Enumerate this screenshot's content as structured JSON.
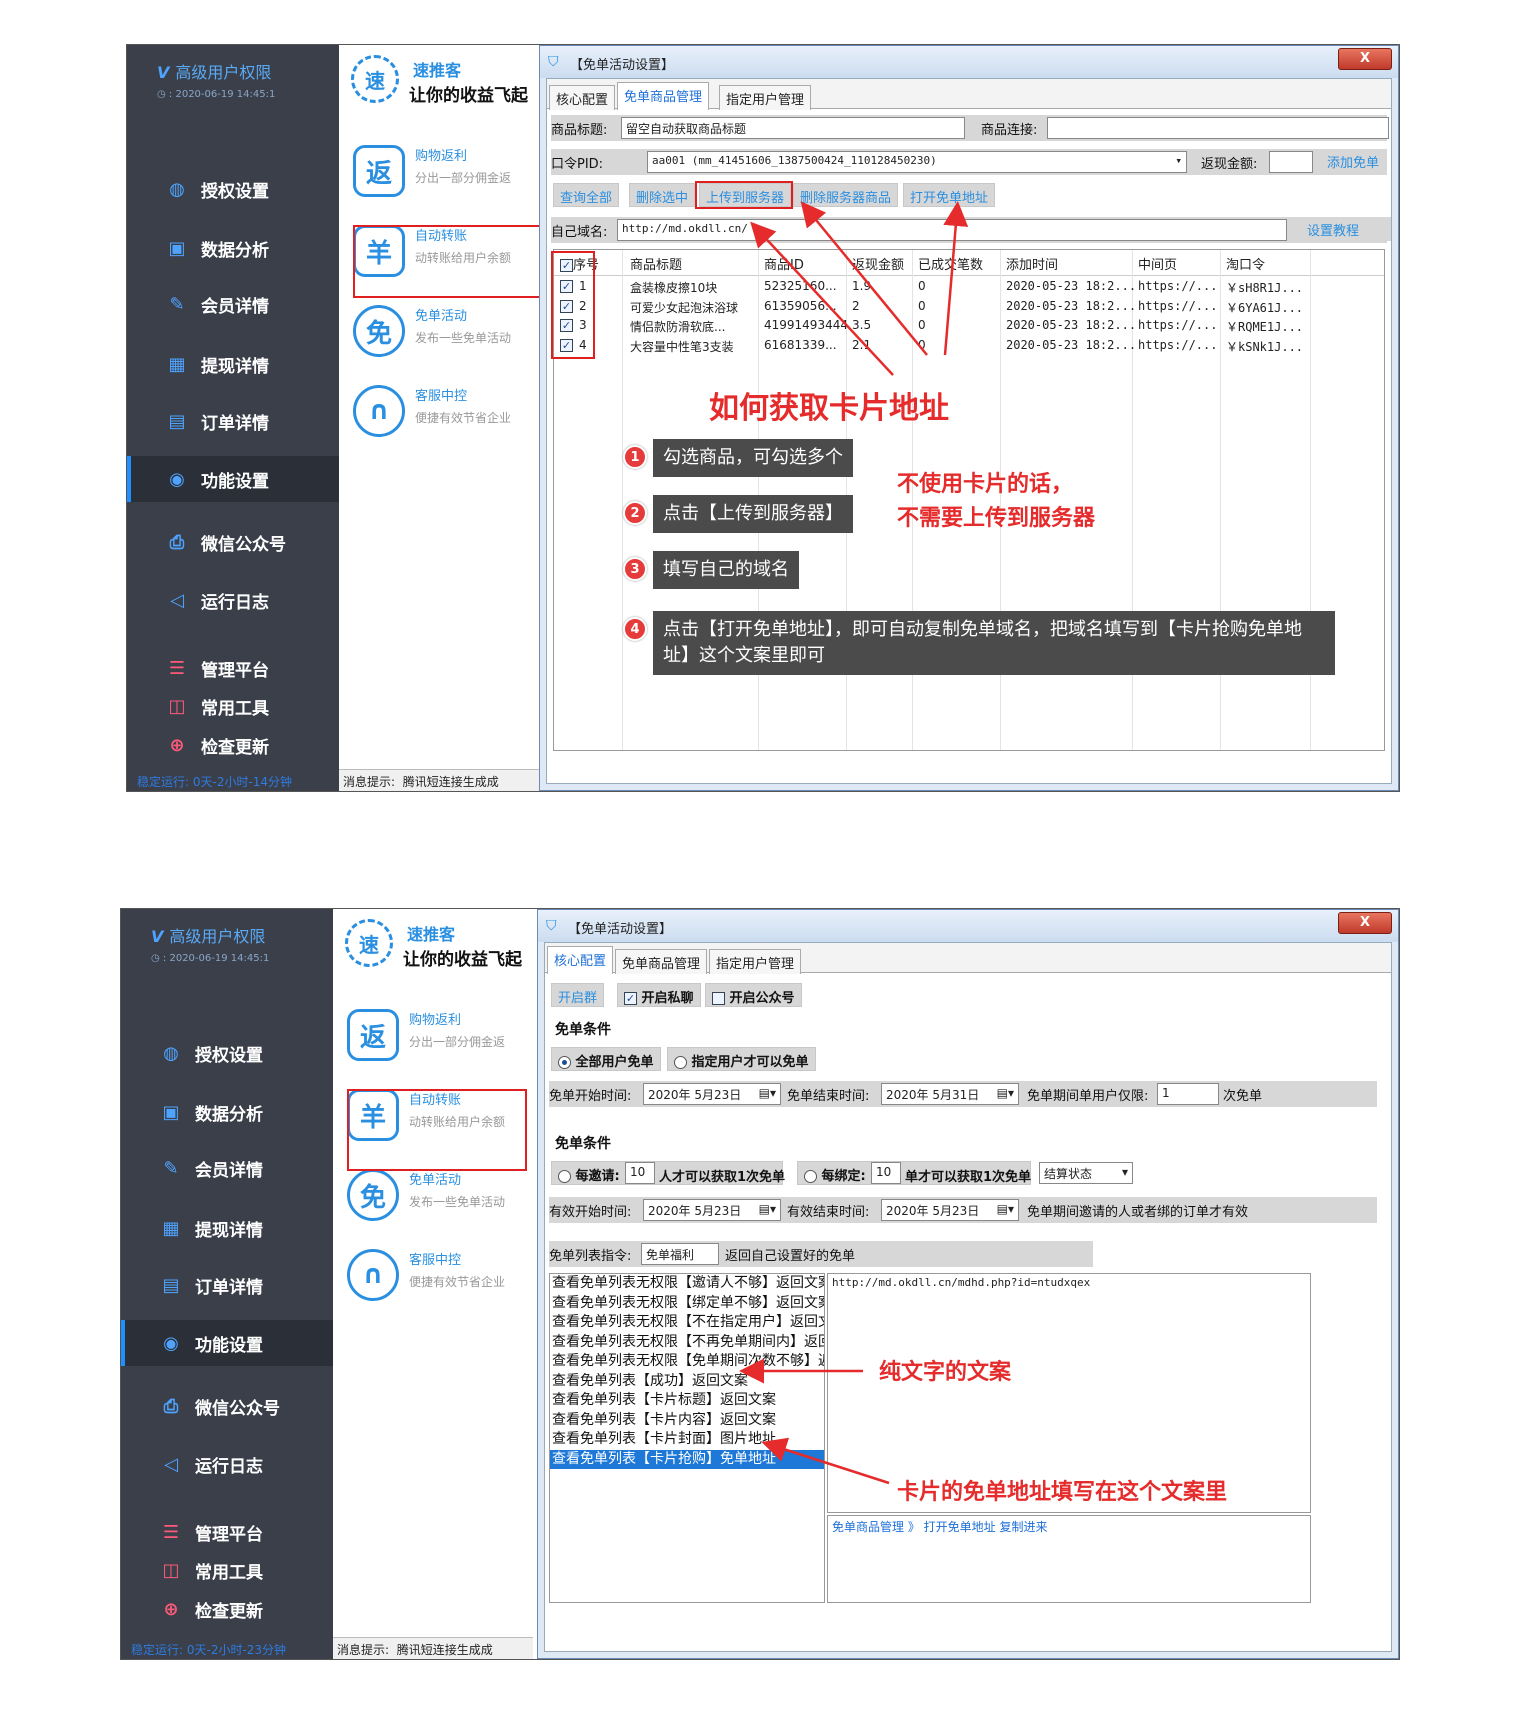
{
  "sidebar": {
    "role_label": "高级用户权限",
    "timestamp": ": 2020-06-19 14:45:1",
    "items": [
      {
        "label": "授权设置",
        "icon": "globe-icon"
      },
      {
        "label": "数据分析",
        "icon": "monitor-icon"
      },
      {
        "label": "会员详情",
        "icon": "edit-icon"
      },
      {
        "label": "提现详情",
        "icon": "grid-search-icon"
      },
      {
        "label": "订单详情",
        "icon": "order-icon"
      },
      {
        "label": "功能设置",
        "icon": "wechat-icon"
      },
      {
        "label": "微信公众号",
        "icon": "printer-icon"
      },
      {
        "label": "运行日志",
        "icon": "speaker-icon"
      },
      {
        "label": "管理平台",
        "icon": "server-icon"
      },
      {
        "label": "常用工具",
        "icon": "chart-icon"
      },
      {
        "label": "检查更新",
        "icon": "update-icon"
      }
    ],
    "uptime_top": "稳定运行: 0天-2小时-14分钟",
    "uptime_bottom": "稳定运行: 0天-2小时-23分钟"
  },
  "brand": {
    "logo_char": "速",
    "name": "速推客",
    "slogan": "让你的收益飞起"
  },
  "features": [
    {
      "icon": "返",
      "title": "购物返利",
      "desc": "分出一部分佣金返"
    },
    {
      "icon": "羊",
      "title": "自动转账",
      "desc": "动转账给用户余额"
    },
    {
      "icon": "免",
      "title": "免单活动",
      "desc": "发布一些免单活动"
    },
    {
      "icon": "∩",
      "title": "客服中控",
      "desc": "便捷有效节省企业"
    }
  ],
  "statusbar": {
    "prefix": "消息提示:",
    "message": "腾讯短连接生成成"
  },
  "dialog": {
    "title": "【免单活动设置】",
    "close": "X",
    "tabs": [
      "核心配置",
      "免单商品管理",
      "指定用户管理"
    ]
  },
  "top_panel": {
    "product_title_label": "商品标题:",
    "product_title_value": "留空自动获取商品标题",
    "product_link_label": "商品连接:",
    "pid_label": "口令PID:",
    "pid_value": "aa001 (mm_41451606_1387500424_110128450230)",
    "cashback_label": "返现金额:",
    "add_btn": "添加免单",
    "buttons": [
      "查询全部",
      "删除选中",
      "上传到服务器",
      "删除服务器商品",
      "打开免单地址"
    ],
    "domain_label": "自己域名:",
    "domain_value": "http://md.okdll.cn/",
    "tutorial_btn": "设置教程",
    "columns": [
      "序号",
      "商品标题",
      "商品ID",
      "返现金额",
      "已成交笔数",
      "添加时间",
      "中间页",
      "淘口令"
    ],
    "rows": [
      [
        "1",
        "盒装橡皮擦10块",
        "52325160...",
        "1.9",
        "0",
        "2020-05-23 18:2...",
        "https://...",
        "￥sH8R1J..."
      ],
      [
        "2",
        "可爱少女起泡沫浴球",
        "61359056...",
        "2",
        "0",
        "2020-05-23 18:2...",
        "https://...",
        "￥6YA61J..."
      ],
      [
        "3",
        "情侣款防滑软底...",
        "41991493444",
        "3.5",
        "0",
        "2020-05-23 18:2...",
        "https://...",
        "￥RQME1J..."
      ],
      [
        "4",
        "大容量中性笔3支装",
        "61681339...",
        "2.1",
        "0",
        "2020-05-23 18:2...",
        "https://...",
        "￥kSNk1J..."
      ]
    ],
    "annot_title": "如何获取卡片地址",
    "steps": [
      {
        "num": "1",
        "text": "勾选商品，可勾选多个"
      },
      {
        "num": "2",
        "text": "点击【上传到服务器】"
      },
      {
        "num": "3",
        "text": "填写自己的域名"
      },
      {
        "num": "4",
        "text": "点击【打开免单地址】，即可自动复制免单域名，把域名填写到【卡片抢购免单地址】这个文案里即可"
      }
    ],
    "side_note_1": "不使用卡片的话，",
    "side_note_2": "不需要上传到服务器"
  },
  "bottom_panel": {
    "btn_group": "开启群",
    "chk_private": "开启私聊",
    "chk_public": "开启公众号",
    "sec1": "免单条件",
    "radio_all": "全部用户免单",
    "radio_specified": "指定用户才可以免单",
    "start_label": "免单开始时间:",
    "start_value": "2020年 5月23日",
    "end_label": "免单结束时间:",
    "end_value": "2020年 5月31日",
    "limit_label": "免单期间单用户仅限:",
    "limit_value": "1",
    "limit_unit": "次免单",
    "sec2": "免单条件",
    "invite_label": "每邀请:",
    "invite_value": "10",
    "invite_suffix": "人才可以获取1次免单",
    "bind_label": "每绑定:",
    "bind_value": "10",
    "bind_suffix": "单才可以获取1次免单",
    "settle_value": "结算状态",
    "valid_start_label": "有效开始时间:",
    "valid_start_value": "2020年 5月23日",
    "valid_end_label": "有效结束时间:",
    "valid_end_value": "2020年 5月23日",
    "valid_note": "免单期间邀请的人或者绑的订单才有效",
    "cmd_label": "免单列表指令:",
    "cmd_value": "免单福利",
    "cmd_note": "返回自己设置好的免单",
    "list": [
      "查看免单列表无权限【邀请人不够】返回文案",
      "查看免单列表无权限【绑定单不够】返回文案",
      "查看免单列表无权限【不在指定用户】返回文案",
      "查看免单列表无权限【不再免单期间内】返回文",
      "查看免单列表无权限【免单期间次数不够】返回",
      "查看免单列表【成功】返回文案",
      "查看免单列表【卡片标题】返回文案",
      "查看免单列表【卡片内容】返回文案",
      "查看免单列表【卡片封面】图片地址",
      "查看免单列表【卡片抢购】免单地址"
    ],
    "content_value": "http://md.okdll.cn/mdhd.php?id=ntudxqex",
    "bottom_link": "免单商品管理 》 打开免单地址 复制进来",
    "annot_text": "纯文字的文案",
    "annot_card": "卡片的免单地址填写在这个文案里"
  }
}
